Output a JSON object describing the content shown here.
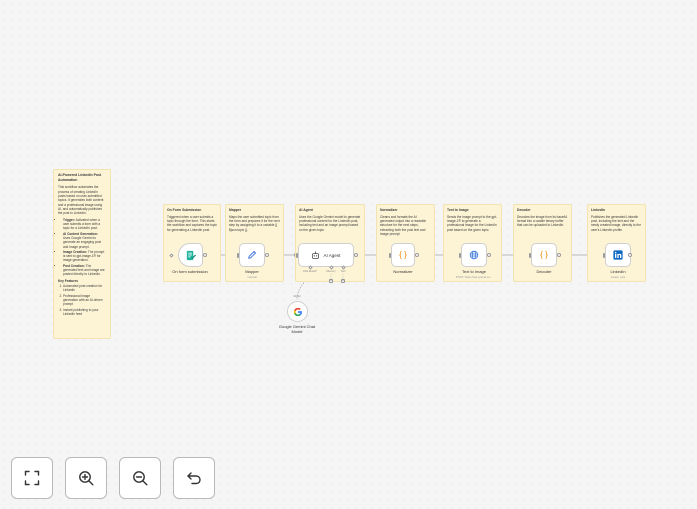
{
  "colors": {
    "canvas_bg": "#f5f5f5",
    "sticky_bg": "#fdf3d5",
    "node_border": "#cfcfcf",
    "accent_orange": "#ff6d5a",
    "linkedin_blue": "#0a66c2"
  },
  "main_note": {
    "title": "AI-Powered LinkedIn Post Automation",
    "intro": "This workflow automates the process of creating LinkedIn posts based on user-submitted topics. It generates both content and a professional image using AI, and automatically publishes the post to LinkedIn.",
    "steps": [
      {
        "head": "Trigger:",
        "text": "Activated when a user submits a form with a topic for a LinkedIn post."
      },
      {
        "head": "AI Content Generation:",
        "text": "Uses Google Gemini to generate an engaging post and image prompt."
      },
      {
        "head": "Image Creation:",
        "text": "The prompt is sent to gpt-image-1® for image generation."
      },
      {
        "head": "Post Creation:",
        "text": "The generated text and image are posted directly to LinkedIn."
      }
    ],
    "key_features_title": "Key Features",
    "features": [
      "Automated post creation for LinkedIn",
      "Professional image generation with an AI-driven prompt",
      "Instant publishing to your LinkedIn feed"
    ]
  },
  "notes": [
    {
      "title": "On Form Submission",
      "body": "Triggered when a user submits a topic through the form. This starts the workflow and captures the topic for generating a LinkedIn post."
    },
    {
      "title": "Mapper",
      "body": "Maps the user submitted topic from the form and prepares it for the next step by assigning it to a variable {{ $json.topic }}."
    },
    {
      "title": "AI Agent",
      "body": "Uses the Google Gemini model to generate professional content for the LinkedIn post, including text and an image prompt based on the given topic."
    },
    {
      "title": "Normalizer",
      "body": "Cleans and formats the AI generated output into a readable structure for the next steps, extracting both the post text and image prompt."
    },
    {
      "title": "Text to Image",
      "body": "Sends the image prompt to the gpt-image-1® to generate a professional image for the LinkedIn post based on the given topic."
    },
    {
      "title": "Decoder",
      "body": "Decodes the image from its base64 format into a usable binary buffer that can be uploaded to LinkedIn."
    },
    {
      "title": "LinkedIn",
      "body": "Publishes the generated LinkedIn post, including the text and the newly created image, directly to the user's LinkedIn profile."
    }
  ],
  "nodes": {
    "form": {
      "label": "On form submission",
      "icon": "form-icon"
    },
    "mapper": {
      "label": "Mapper",
      "sub": "manual",
      "icon": "pencil-icon"
    },
    "agent": {
      "label": "AI Agent",
      "icon": "robot-icon",
      "port_chat": "Chat Model*",
      "port_memory": "Memory",
      "port_tool": "Tool"
    },
    "normalizer": {
      "label": "Normalizer",
      "icon": "code-braces-icon"
    },
    "text_to_image": {
      "label": "Text to Image",
      "sub": "POST: https://api.openai.co...",
      "icon": "globe-icon"
    },
    "decoder": {
      "label": "Decoder",
      "icon": "code-braces-icon"
    },
    "linkedin": {
      "label": "LinkedIn",
      "sub": "create: post",
      "icon": "linkedin-icon"
    },
    "gemini": {
      "label": "Google Gemini Chat Model",
      "port": "Model",
      "icon": "google-g-icon"
    }
  },
  "controls": [
    {
      "name": "fit-view-button",
      "icon": "fit-view-icon"
    },
    {
      "name": "zoom-in-button",
      "icon": "zoom-in-icon"
    },
    {
      "name": "zoom-out-button",
      "icon": "zoom-out-icon"
    },
    {
      "name": "undo-button",
      "icon": "undo-icon"
    }
  ]
}
